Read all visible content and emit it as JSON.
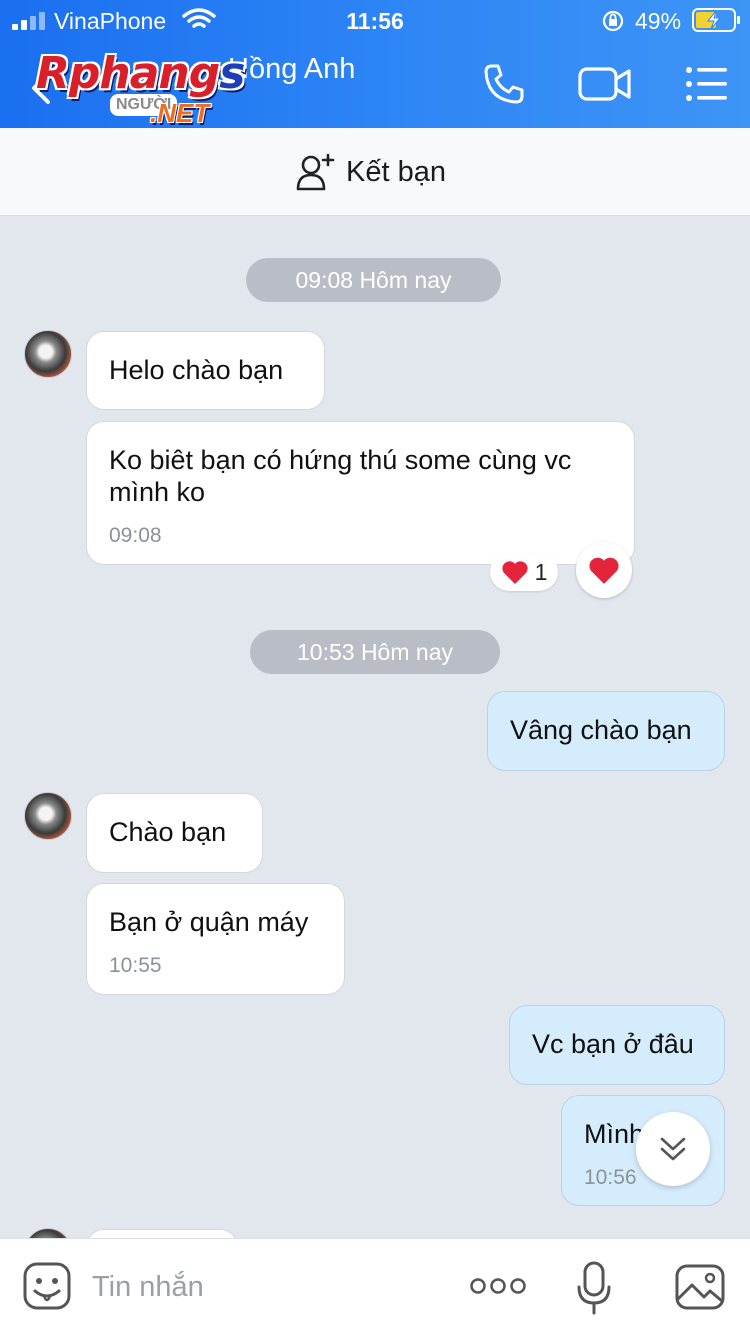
{
  "status_bar": {
    "carrier": "VinaPhone",
    "time": "11:56",
    "battery": "49%"
  },
  "header": {
    "contact_name": "Hồng Anh",
    "logo_main_a": "Rphang",
    "logo_main_b": "s",
    "logo_sub": "NGƯỜI",
    "logo_net": ".NET"
  },
  "friend_bar": {
    "label": "Kết bạn"
  },
  "dates": [
    "09:08 Hôm nay",
    "10:53 Hôm nay"
  ],
  "messages": [
    {
      "text": "Helo chào bạn"
    },
    {
      "line1": "Ko biêt bạn có hứng thú some cùng vc",
      "line2": "mình ko",
      "time": "09:08"
    },
    {
      "text": "Vâng chào bạn"
    },
    {
      "text": "Chào bạn"
    },
    {
      "text": "Bạn ở quận máy",
      "time": "10:55"
    },
    {
      "text": "Vc bạn ở đâu"
    },
    {
      "text": "Mình",
      "time": "10:56"
    }
  ],
  "reaction": {
    "count": "1"
  },
  "input": {
    "placeholder": "Tin nhắn"
  }
}
